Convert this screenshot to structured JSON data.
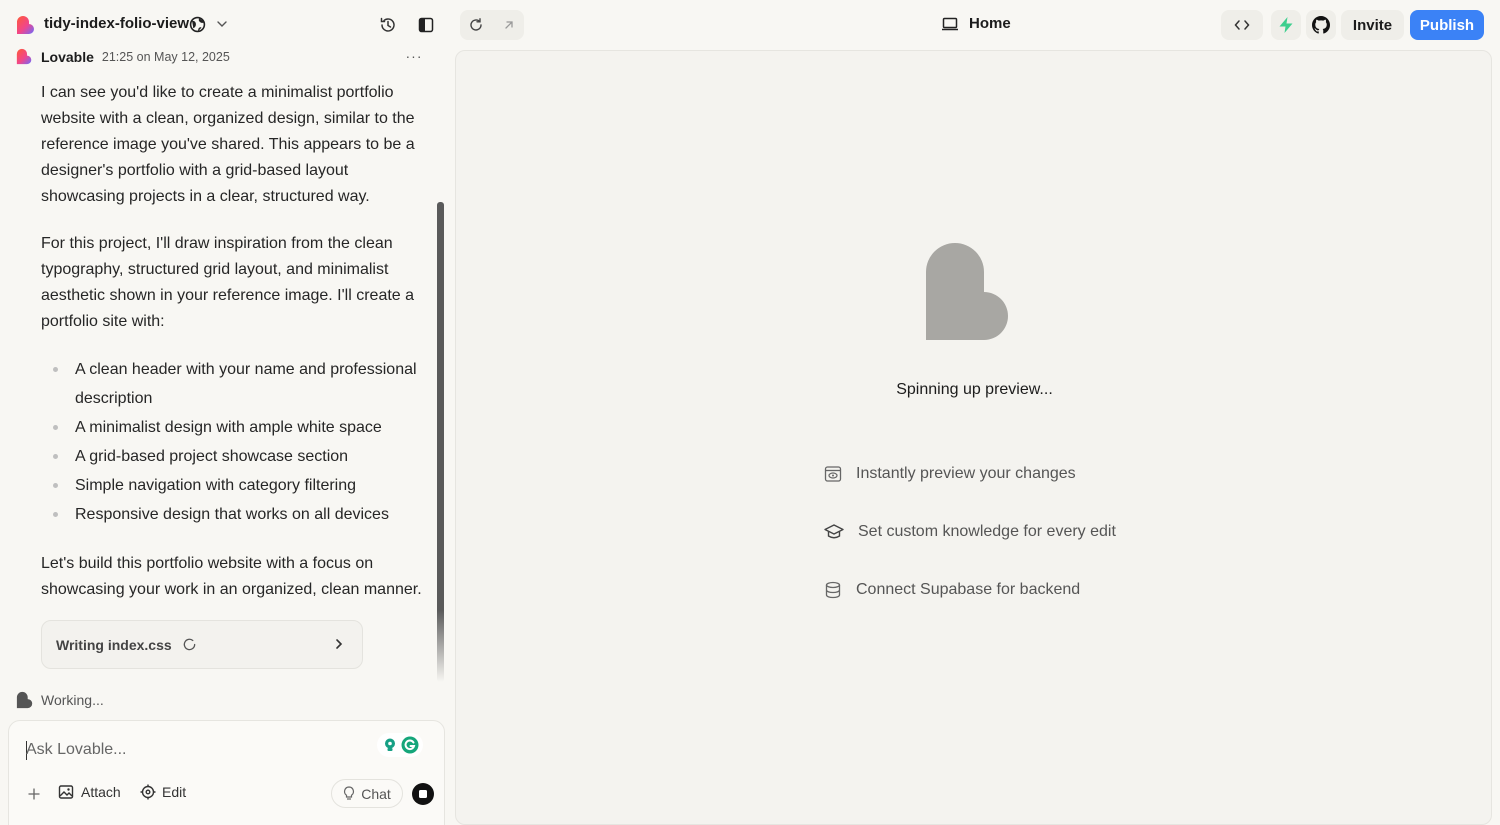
{
  "header": {
    "project_name": "tidy-index-folio-view",
    "page_label": "Home",
    "invite_label": "Invite",
    "publish_label": "Publish"
  },
  "chat": {
    "sender": "Lovable",
    "timestamp": "21:25 on May 12, 2025",
    "paragraphs": [
      "I can see you'd like to create a minimalist portfolio website with a clean, organized design, similar to the reference image you've shared. This appears to be a designer's portfolio with a grid-based layout showcasing projects in a clear, structured way.",
      "For this project, I'll draw inspiration from the clean typography, structured grid layout, and minimalist aesthetic shown in your reference image. I'll create a portfolio site with:",
      "Let's build this portfolio website with a focus on showcasing your work in an organized, clean manner."
    ],
    "bullets": [
      "A clean header with your name and professional description",
      "A minimalist design with ample white space",
      "A grid-based project showcase section",
      "Simple navigation with category filtering",
      "Responsive design that works on all devices"
    ],
    "writing_card_label": "Writing index.css",
    "working_label": "Working..."
  },
  "input": {
    "placeholder": "Ask Lovable...",
    "attach_label": "Attach",
    "edit_label": "Edit",
    "chat_label": "Chat"
  },
  "preview": {
    "status": "Spinning up preview...",
    "features": [
      "Instantly preview your changes",
      "Set custom knowledge for every edit",
      "Connect Supabase for backend"
    ]
  },
  "icons": {
    "logo": "lovable-logo-icon",
    "visibility": "globe-icon",
    "history": "history-icon",
    "sidebar": "sidebar-toggle-icon",
    "refresh": "refresh-icon",
    "open": "external-link-icon",
    "page": "monitor-icon",
    "code": "code-icon",
    "supabase": "bolt-icon",
    "github": "github-icon"
  },
  "colors": {
    "accent": "#3b82f6",
    "bolt": "#3ecf8e",
    "background": "#f8f7f3",
    "preview_logo": "#a8a7a3"
  }
}
